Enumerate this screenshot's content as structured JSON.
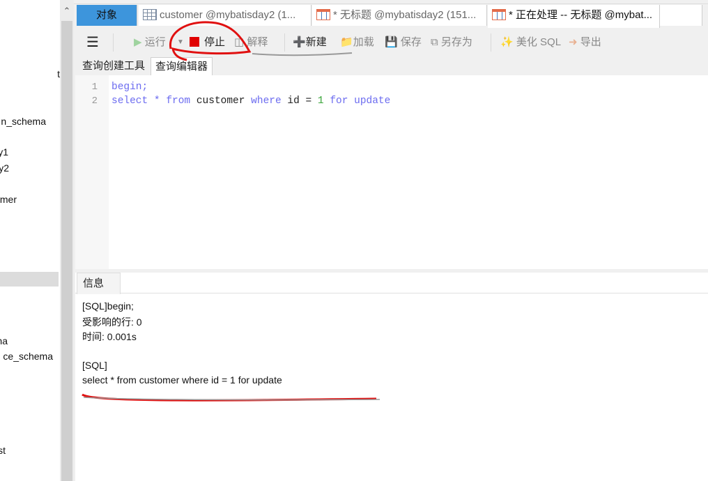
{
  "sidebar": {
    "items": [
      "t",
      "n_schema",
      "y1",
      "y2",
      "mer",
      "na",
      "ce_schema",
      "st"
    ]
  },
  "tabs": [
    {
      "label": "对象"
    },
    {
      "label": "customer @mybatisday2 (1...",
      "icon": "table-icon"
    },
    {
      "label": "* 无标题 @mybatisday2 (151...",
      "icon": "query-icon"
    },
    {
      "label": "* 正在处理 -- 无标题 @mybat...",
      "icon": "query-icon",
      "active": true
    }
  ],
  "toolbar": {
    "menu": "menu-icon",
    "run": "运行",
    "stop": "停止",
    "explain": "解释",
    "new": "新建",
    "load": "加载",
    "save": "保存",
    "save_as": "另存为",
    "beautify": "美化 SQL",
    "export": "导出"
  },
  "subtabs": [
    "查询创建工具",
    "查询编辑器"
  ],
  "editor": {
    "line_numbers": [
      "1",
      "2"
    ]
  },
  "messages": {
    "tab": "信息",
    "lines": [
      "[SQL]begin;",
      "受影响的行: 0",
      "时间: 0.001s",
      "[SQL]",
      "select * from customer where id = 1 for update"
    ]
  },
  "colors": {
    "accent": "#3d95dc",
    "stop": "#e00000",
    "keyword": "#6b6bf0",
    "annotation": "#e01010"
  }
}
